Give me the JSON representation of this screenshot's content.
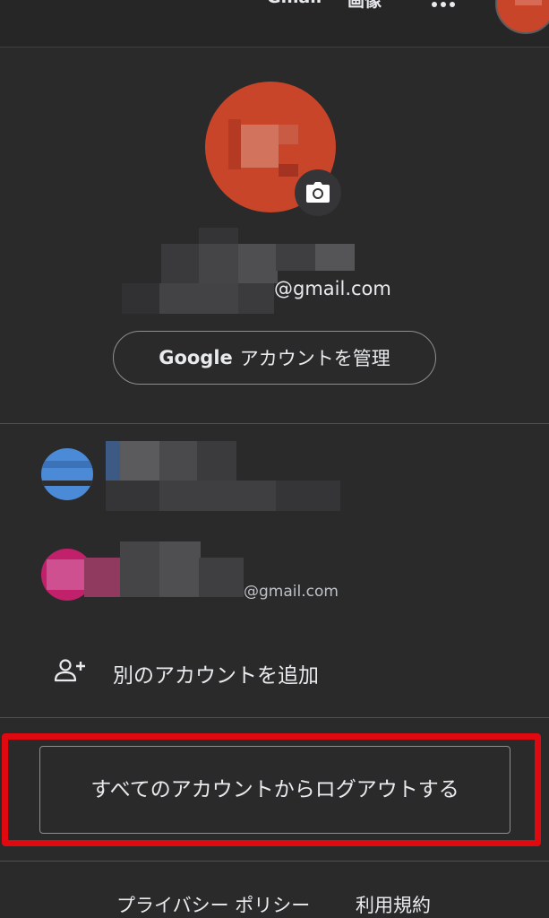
{
  "topbar": {
    "gmail_label": "Gmail",
    "images_label": "画像",
    "apps_icon": "apps-grid-icon"
  },
  "profile": {
    "email_suffix": "@gmail.com",
    "manage_button_brand": "Google",
    "manage_button_label": "アカウントを管理",
    "avatar_color": "#c9452a",
    "camera_icon": "camera-icon"
  },
  "accounts": [
    {
      "email_suffix": "",
      "avatar_color": "#4a8ad6"
    },
    {
      "email_suffix": "@gmail.com",
      "avatar_color": "#c1206a"
    }
  ],
  "add_account": {
    "label": "別のアカウントを追加",
    "icon": "person-add-icon"
  },
  "logout": {
    "label": "すべてのアカウントからログアウトする",
    "highlight_color": "#e0090f"
  },
  "footer": {
    "privacy_label": "プライバシー ポリシー",
    "terms_label": "利用規約"
  }
}
